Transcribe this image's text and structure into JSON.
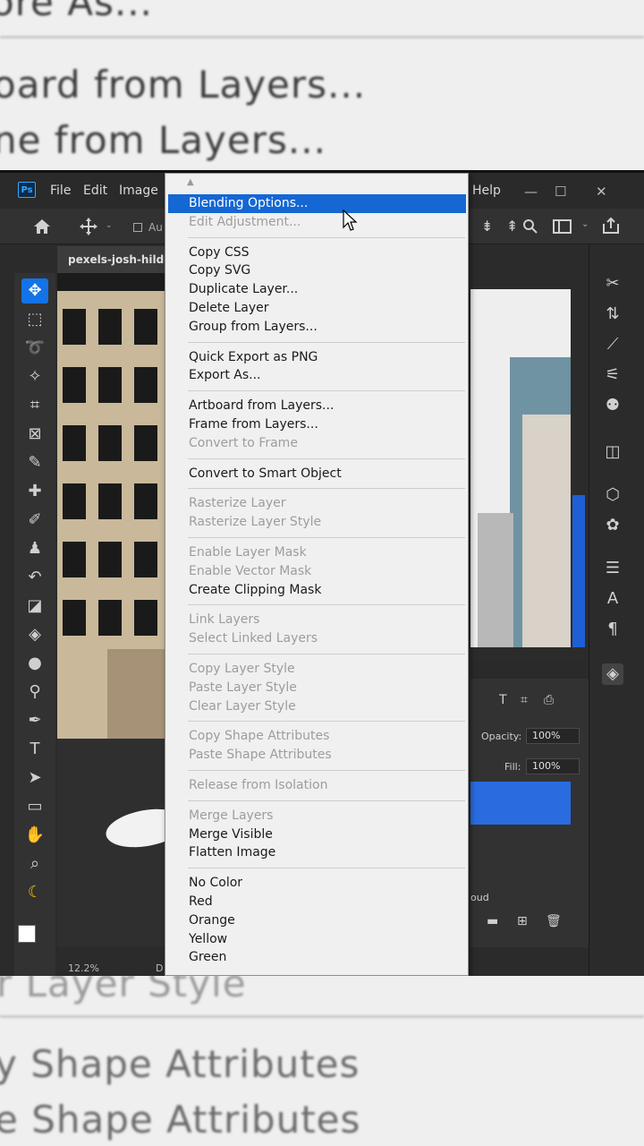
{
  "zoom_top": {
    "line1": "ore As...",
    "line2": "oard from Layers...",
    "line3": "ne from Layers..."
  },
  "zoom_bottom": {
    "line1": "r Layer Style",
    "line2": "y Shape Attributes",
    "line3": "e Shape Attributes"
  },
  "menubar": {
    "logo": "Ps",
    "items": [
      "File",
      "Edit",
      "Image",
      "Help"
    ],
    "window_controls": [
      "—",
      "☐",
      "✕"
    ]
  },
  "document": {
    "tab_title": "pexels-josh-hild-",
    "zoom": "12.2%",
    "status_extra": "D"
  },
  "layers_panel": {
    "opacity_label": "Opacity:",
    "opacity_value": "100%",
    "fill_label": "Fill:",
    "fill_value": "100%",
    "layer_name_fragment": "oud"
  },
  "options_bar": {
    "auto_label": "Au"
  },
  "context_menu": {
    "groups": [
      [
        {
          "label": "Blending Options...",
          "enabled": true,
          "highlighted": true
        },
        {
          "label": "Edit Adjustment...",
          "enabled": false
        }
      ],
      [
        {
          "label": "Copy CSS",
          "enabled": true
        },
        {
          "label": "Copy SVG",
          "enabled": true
        },
        {
          "label": "Duplicate Layer...",
          "enabled": true
        },
        {
          "label": "Delete Layer",
          "enabled": true
        },
        {
          "label": "Group from Layers...",
          "enabled": true
        }
      ],
      [
        {
          "label": "Quick Export as PNG",
          "enabled": true
        },
        {
          "label": "Export As...",
          "enabled": true
        }
      ],
      [
        {
          "label": "Artboard from Layers...",
          "enabled": true
        },
        {
          "label": "Frame from Layers...",
          "enabled": true
        },
        {
          "label": "Convert to Frame",
          "enabled": false
        }
      ],
      [
        {
          "label": "Convert to Smart Object",
          "enabled": true
        }
      ],
      [
        {
          "label": "Rasterize Layer",
          "enabled": false
        },
        {
          "label": "Rasterize Layer Style",
          "enabled": false
        }
      ],
      [
        {
          "label": "Enable Layer Mask",
          "enabled": false
        },
        {
          "label": "Enable Vector Mask",
          "enabled": false
        },
        {
          "label": "Create Clipping Mask",
          "enabled": true
        }
      ],
      [
        {
          "label": "Link Layers",
          "enabled": false
        },
        {
          "label": "Select Linked Layers",
          "enabled": false
        }
      ],
      [
        {
          "label": "Copy Layer Style",
          "enabled": false
        },
        {
          "label": "Paste Layer Style",
          "enabled": false
        },
        {
          "label": "Clear Layer Style",
          "enabled": false
        }
      ],
      [
        {
          "label": "Copy Shape Attributes",
          "enabled": false
        },
        {
          "label": "Paste Shape Attributes",
          "enabled": false
        }
      ],
      [
        {
          "label": "Release from Isolation",
          "enabled": false
        }
      ],
      [
        {
          "label": "Merge Layers",
          "enabled": false
        },
        {
          "label": "Merge Visible",
          "enabled": true
        },
        {
          "label": "Flatten Image",
          "enabled": true
        }
      ],
      [
        {
          "label": "No Color",
          "enabled": true
        },
        {
          "label": "Red",
          "enabled": true
        },
        {
          "label": "Orange",
          "enabled": true
        },
        {
          "label": "Yellow",
          "enabled": true
        },
        {
          "label": "Green",
          "enabled": true
        }
      ]
    ]
  },
  "colors": {
    "highlight": "#1567d3",
    "menu_bg": "#f0f0f0",
    "disabled_text": "#9d9d9d",
    "ps_dark": "#2b2b2b"
  }
}
